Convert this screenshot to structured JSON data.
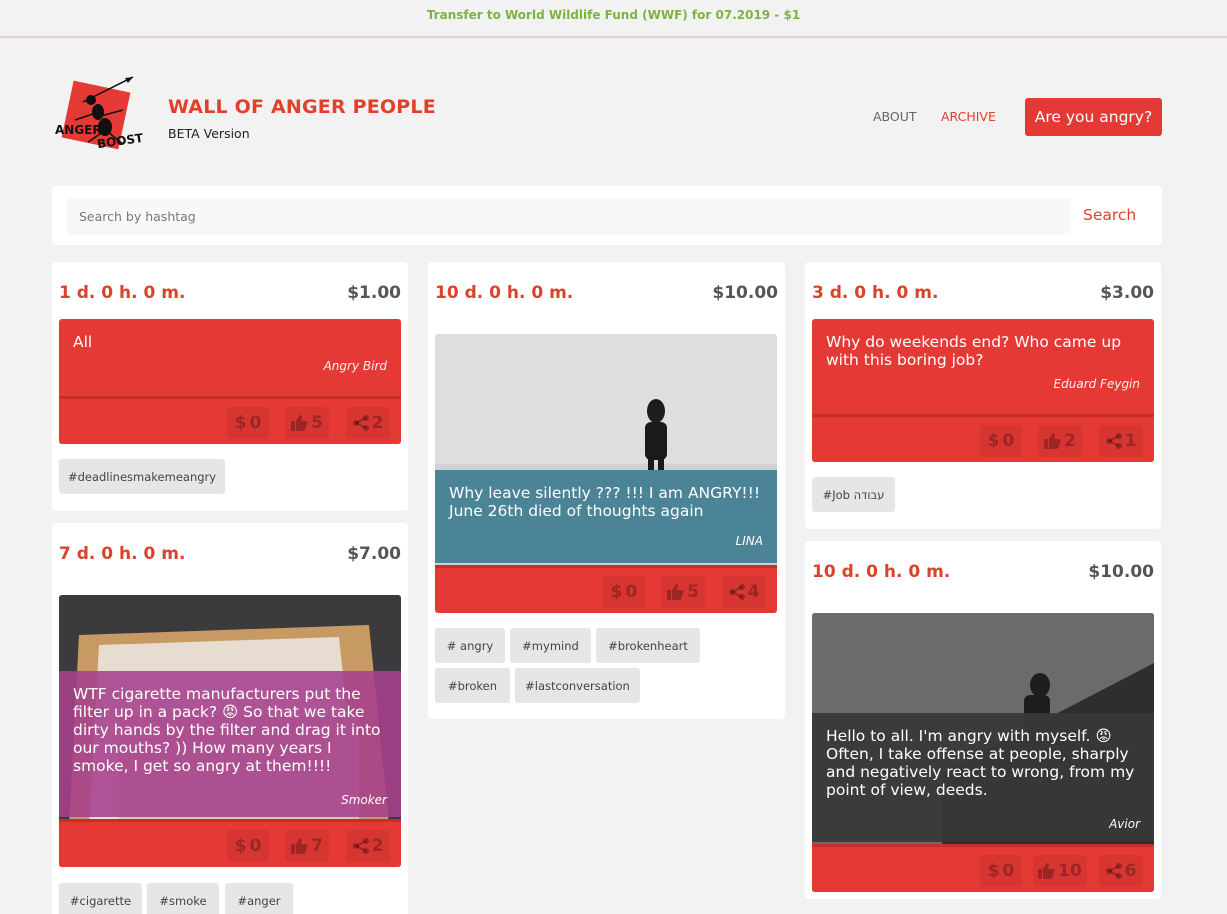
{
  "banner": "Transfer to World Wildlife Fund (WWF) for 07.2019 - $1",
  "brand": {
    "logo_text_1": "ANGER",
    "logo_text_2": "BOOST",
    "title": "WALL OF ANGER PEOPLE",
    "subtitle": "BETA Version"
  },
  "nav": {
    "about": "ABOUT",
    "archive": "ARCHIVE",
    "cta": "Are you angry?"
  },
  "search": {
    "placeholder": "Search by hashtag",
    "button": "Search"
  },
  "colors": {
    "accent": "#e53935",
    "title_red": "#e0412b",
    "banner_green": "#7cb342"
  },
  "cards": [
    {
      "timer": "1 d. 0 h. 0 m.",
      "amount": "$1.00",
      "message": "All",
      "author": "Angry Bird",
      "donations": "0",
      "likes": "5",
      "shares": "2",
      "tags": [
        "#deadlinesmakemeangry"
      ]
    },
    {
      "timer": "7 d. 0 h. 0 m.",
      "amount": "$7.00",
      "message": "WTF cigarette manufacturers put the filter up in a pack? 😡 So that we take dirty hands by the filter and drag it into our mouths? )) How many years I smoke, I get so angry at them!!!!",
      "author": "Smoker",
      "donations": "0",
      "likes": "7",
      "shares": "2",
      "tags": [
        "#cigarette",
        "#smoke",
        "#anger"
      ]
    },
    {
      "timer": "10 d. 0 h. 0 m.",
      "amount": "$10.00",
      "message": "Why leave silently ??? !!! I am ANGRY!!! June 26th died of thoughts again",
      "author": "LINA",
      "donations": "0",
      "likes": "5",
      "shares": "4",
      "tags": [
        "# angry",
        "#mymind",
        "#brokenheart",
        "#broken",
        "#lastconversation"
      ]
    },
    {
      "timer": "3 d. 0 h. 0 m.",
      "amount": "$3.00",
      "message": "Why do weekends end? Who came up with this boring job?",
      "author": "Eduard Feygin",
      "donations": "0",
      "likes": "2",
      "shares": "1",
      "tags": [
        "#Job עבודה"
      ]
    },
    {
      "timer": "10 d. 0 h. 0 m.",
      "amount": "$10.00",
      "message": "Hello to all. I'm angry with myself. 😡 Often, I take offense at people, sharply and negatively react to wrong, from my point of view, deeds.",
      "author": "Avior",
      "donations": "0",
      "likes": "10",
      "shares": "6",
      "tags": []
    }
  ],
  "icons": {
    "donate": "dollar-icon",
    "like": "thumbs-up-icon",
    "share": "share-icon"
  }
}
